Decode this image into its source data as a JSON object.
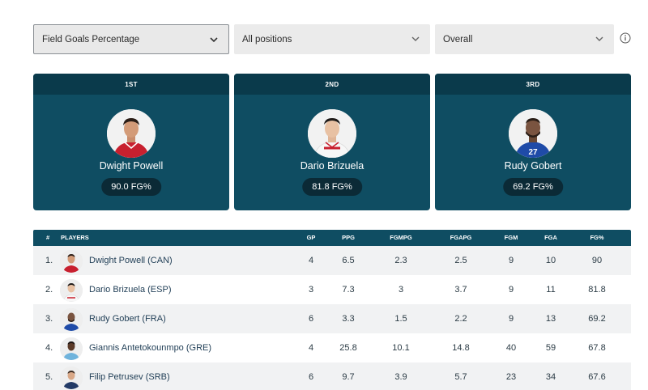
{
  "filters": {
    "stat": "Field Goals Percentage",
    "position": "All positions",
    "scope": "Overall"
  },
  "podium": [
    {
      "rank": "1ST",
      "name": "Dwight Powell",
      "stat": "90.0 FG%",
      "jersey_color": "#c8202f",
      "jersey_number": ""
    },
    {
      "rank": "2ND",
      "name": "Dario Brizuela",
      "stat": "81.8 FG%",
      "jersey_color": "#f4f4f4",
      "jersey_number": ""
    },
    {
      "rank": "3RD",
      "name": "Rudy Gobert",
      "stat": "69.2 FG%",
      "jersey_color": "#1f4ba8",
      "jersey_number": "27"
    }
  ],
  "table": {
    "headers": [
      "#",
      "PLAYERS",
      "GP",
      "PPG",
      "FGMPG",
      "FGAPG",
      "FGM",
      "FGA",
      "FG%"
    ],
    "rows": [
      {
        "rank": "1.",
        "player": "Dwight Powell (CAN)",
        "gp": "4",
        "ppg": "6.5",
        "fgmpg": "2.3",
        "fgapg": "2.5",
        "fgm": "9",
        "fga": "10",
        "fgp": "90"
      },
      {
        "rank": "2.",
        "player": "Dario Brizuela (ESP)",
        "gp": "3",
        "ppg": "7.3",
        "fgmpg": "3",
        "fgapg": "3.7",
        "fgm": "9",
        "fga": "11",
        "fgp": "81.8"
      },
      {
        "rank": "3.",
        "player": "Rudy Gobert (FRA)",
        "gp": "6",
        "ppg": "3.3",
        "fgmpg": "1.5",
        "fgapg": "2.2",
        "fgm": "9",
        "fga": "13",
        "fgp": "69.2"
      },
      {
        "rank": "4.",
        "player": "Giannis Antetokounmpo (GRE)",
        "gp": "4",
        "ppg": "25.8",
        "fgmpg": "10.1",
        "fgapg": "14.8",
        "fgm": "40",
        "fga": "59",
        "fgp": "67.8"
      },
      {
        "rank": "5.",
        "player": "Filip Petrusev (SRB)",
        "gp": "6",
        "ppg": "9.7",
        "fgmpg": "3.9",
        "fgapg": "5.7",
        "fgm": "23",
        "fga": "34",
        "fgp": "67.6"
      }
    ]
  },
  "colors": {
    "accent": "#0f4d62",
    "accent_dark": "#0a3a4b",
    "pill": "#0b2a36",
    "row_alt": "#f1f2f3"
  },
  "icons": {
    "dropdown": "chevron-down-icon",
    "info": "info-icon"
  }
}
